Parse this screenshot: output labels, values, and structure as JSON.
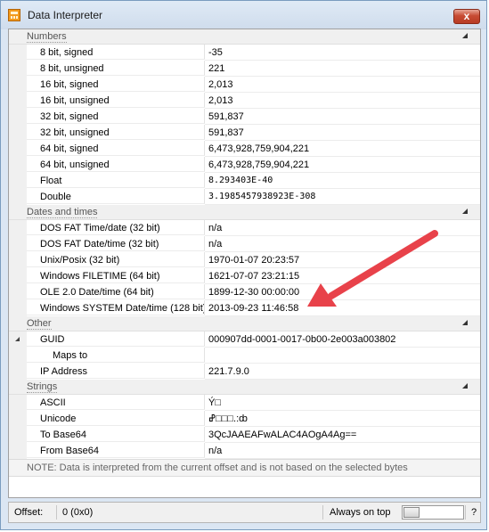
{
  "window": {
    "title": "Data Interpreter",
    "close_label": "x"
  },
  "sections": [
    {
      "name": "Numbers",
      "rows": [
        {
          "label": "8 bit, signed",
          "value": "-35"
        },
        {
          "label": "8 bit, unsigned",
          "value": "221"
        },
        {
          "label": "16 bit, signed",
          "value": "2,013"
        },
        {
          "label": "16 bit, unsigned",
          "value": "2,013"
        },
        {
          "label": "32 bit, signed",
          "value": "591,837"
        },
        {
          "label": "32 bit, unsigned",
          "value": "591,837"
        },
        {
          "label": "64 bit, signed",
          "value": "6,473,928,759,904,221"
        },
        {
          "label": "64 bit, unsigned",
          "value": "6,473,928,759,904,221"
        },
        {
          "label": "Float",
          "value": "8.293403E-40",
          "mono": true
        },
        {
          "label": "Double",
          "value": "3.1985457938923E-308",
          "mono": true
        }
      ]
    },
    {
      "name": "Dates and times",
      "rows": [
        {
          "label": "DOS FAT Time/date (32 bit)",
          "value": "n/a"
        },
        {
          "label": "DOS FAT Date/time (32 bit)",
          "value": "n/a"
        },
        {
          "label": "Unix/Posix (32 bit)",
          "value": "1970-01-07 20:23:57"
        },
        {
          "label": "Windows FILETIME (64 bit)",
          "value": "1621-07-07 23:21:15"
        },
        {
          "label": "OLE 2.0 Date/time (64 bit)",
          "value": "1899-12-30 00:00:00"
        },
        {
          "label": "Windows SYSTEM Date/time (128 bit)",
          "value": "2013-09-23 11:46:58"
        }
      ]
    },
    {
      "name": "Other",
      "rows": [
        {
          "label": "GUID",
          "value": "000907dd-0001-0017-0b00-2e003a003802",
          "expandable": true
        },
        {
          "label": "Maps to",
          "value": "",
          "sub": true
        },
        {
          "label": "IP Address",
          "value": "221.7.9.0"
        }
      ]
    },
    {
      "name": "Strings",
      "rows": [
        {
          "label": "ASCII",
          "value": "Ý□"
        },
        {
          "label": "Unicode",
          "value": "ߝ□□□.:ȸ"
        },
        {
          "label": "To Base64",
          "value": "3QcJAAEAFwALAC4AOgA4Ag=="
        },
        {
          "label": "From Base64",
          "value": "n/a"
        }
      ]
    }
  ],
  "note": "NOTE: Data is interpreted from the current offset and is not based on the selected bytes",
  "statusbar": {
    "offset_label": "Offset:",
    "offset_value": "0 (0x0)",
    "always_on_top_label": "Always on top",
    "always_on_top": false,
    "help_label": "?"
  },
  "annotation": {
    "color": "#e8424a",
    "points_to": "Windows SYSTEM Date/time (128 bit)"
  }
}
